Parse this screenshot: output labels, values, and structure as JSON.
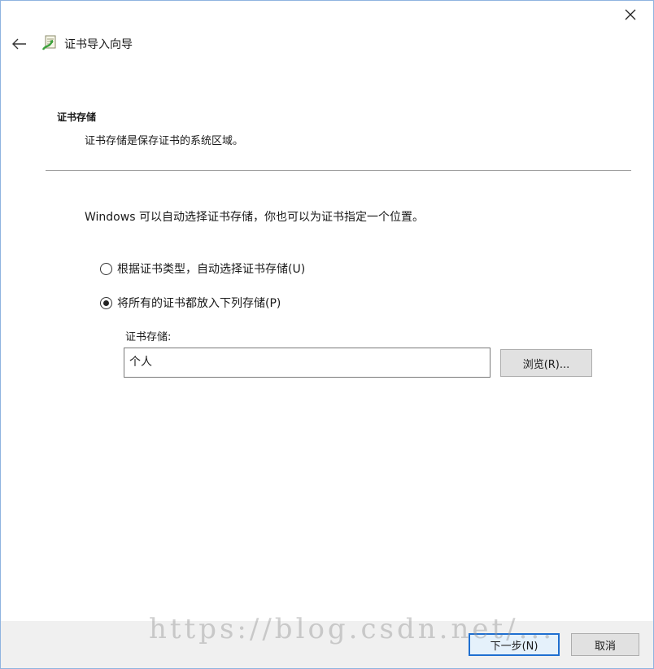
{
  "window": {
    "title": "证书导入向导"
  },
  "icons": {
    "close": "close-icon",
    "back": "back-arrow-icon",
    "wizard": "certificate-wizard-icon"
  },
  "section": {
    "heading": "证书存储",
    "description": "证书存储是保存证书的系统区域。"
  },
  "intro": "Windows 可以自动选择证书存储，你也可以为证书指定一个位置。",
  "options": [
    {
      "label": "根据证书类型，自动选择证书存储(U)",
      "selected": false
    },
    {
      "label": "将所有的证书都放入下列存储(P)",
      "selected": true
    }
  ],
  "store": {
    "label": "证书存储:",
    "value": "个人",
    "browse_label": "浏览(R)..."
  },
  "footer": {
    "next_label": "下一步(N)",
    "cancel_label": "取消"
  },
  "watermark": "https://blog.csdn.net/..."
}
